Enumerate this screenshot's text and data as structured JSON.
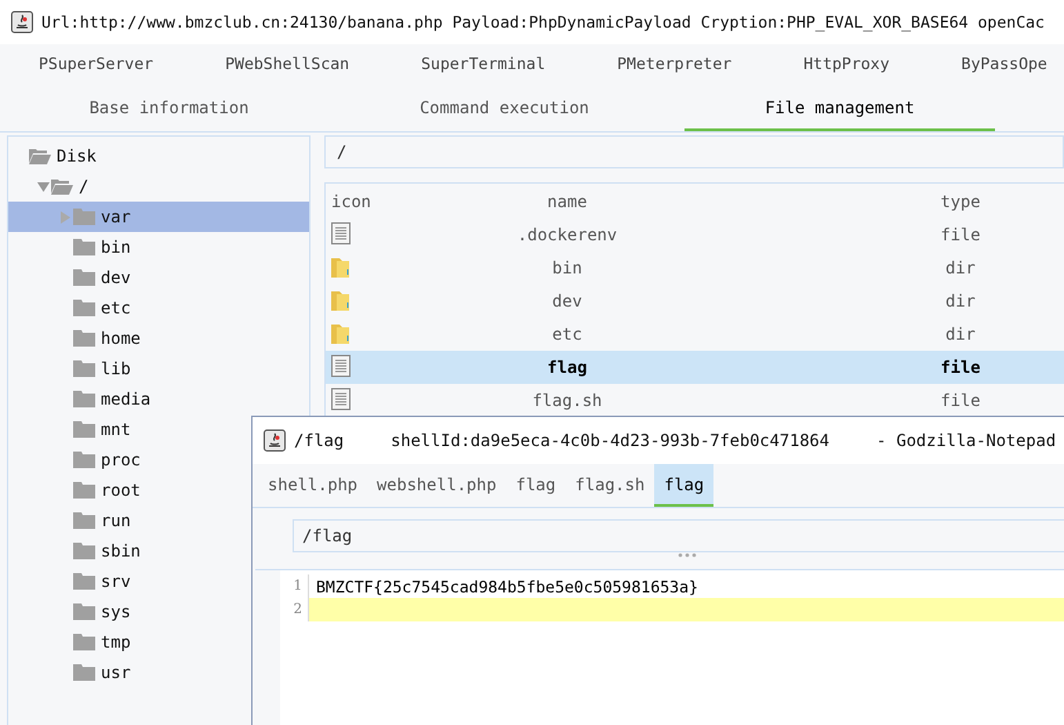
{
  "window": {
    "title": "Url:http://www.bmzclub.cn:24130/banana.php Payload:PhpDynamicPayload Cryption:PHP_EVAL_XOR_BASE64 openCac"
  },
  "plugin_tabs": [
    {
      "label": "PSuperServer",
      "selected": false
    },
    {
      "label": "PWebShellScan",
      "selected": false
    },
    {
      "label": "SuperTerminal",
      "selected": false
    },
    {
      "label": "PMeterpreter",
      "selected": false
    },
    {
      "label": "HttpProxy",
      "selected": false
    },
    {
      "label": "ByPassOpe",
      "selected": false
    }
  ],
  "tabs": [
    {
      "label": "Base information",
      "selected": false
    },
    {
      "label": "Command execution",
      "selected": false
    },
    {
      "label": "File management",
      "selected": true
    }
  ],
  "tree": {
    "items": [
      {
        "label": "Disk",
        "expandable": false,
        "expanded": true,
        "selected": false,
        "children": [
          {
            "label": "/",
            "expandable": true,
            "expanded": true,
            "selected": false,
            "children": [
              {
                "label": "var",
                "expandable": true,
                "expanded": false,
                "selected": true
              },
              {
                "label": "bin",
                "expandable": false,
                "expanded": false,
                "selected": false
              },
              {
                "label": "dev",
                "expandable": false,
                "expanded": false,
                "selected": false
              },
              {
                "label": "etc",
                "expandable": false,
                "expanded": false,
                "selected": false
              },
              {
                "label": "home",
                "expandable": false,
                "expanded": false,
                "selected": false
              },
              {
                "label": "lib",
                "expandable": false,
                "expanded": false,
                "selected": false
              },
              {
                "label": "media",
                "expandable": false,
                "expanded": false,
                "selected": false
              },
              {
                "label": "mnt",
                "expandable": false,
                "expanded": false,
                "selected": false
              },
              {
                "label": "proc",
                "expandable": false,
                "expanded": false,
                "selected": false
              },
              {
                "label": "root",
                "expandable": false,
                "expanded": false,
                "selected": false
              },
              {
                "label": "run",
                "expandable": false,
                "expanded": false,
                "selected": false
              },
              {
                "label": "sbin",
                "expandable": false,
                "expanded": false,
                "selected": false
              },
              {
                "label": "srv",
                "expandable": false,
                "expanded": false,
                "selected": false
              },
              {
                "label": "sys",
                "expandable": false,
                "expanded": false,
                "selected": false
              },
              {
                "label": "tmp",
                "expandable": false,
                "expanded": false,
                "selected": false
              },
              {
                "label": "usr",
                "expandable": false,
                "expanded": false,
                "selected": false
              }
            ]
          }
        ]
      }
    ]
  },
  "file_panel": {
    "path": "/",
    "table": {
      "columns": [
        "icon",
        "name",
        "type"
      ],
      "rows": [
        {
          "kind": "file",
          "name": ".dockerenv",
          "type": "file",
          "selected": false
        },
        {
          "kind": "dir",
          "name": "bin",
          "type": "dir",
          "selected": false
        },
        {
          "kind": "dir",
          "name": "dev",
          "type": "dir",
          "selected": false
        },
        {
          "kind": "dir",
          "name": "etc",
          "type": "dir",
          "selected": false
        },
        {
          "kind": "file",
          "name": "flag",
          "type": "file",
          "selected": true
        },
        {
          "kind": "file",
          "name": "flag.sh",
          "type": "file",
          "selected": false
        }
      ]
    }
  },
  "notepad": {
    "title": "/flag",
    "shell_id": "shellId:da9e5eca-4c0b-4d23-993b-7feb0c471864",
    "app_name": "- Godzilla-Notepad",
    "tabs": [
      {
        "label": "shell.php",
        "selected": false
      },
      {
        "label": "webshell.php",
        "selected": false
      },
      {
        "label": "flag",
        "selected": false
      },
      {
        "label": "flag.sh",
        "selected": false
      },
      {
        "label": "flag",
        "selected": true
      }
    ],
    "path": "/flag",
    "lines": [
      {
        "number": "1",
        "text": "BMZCTF{25c7545cad984b5fbe5e0c505981653a}",
        "current": false
      },
      {
        "number": "2",
        "current": true
      }
    ]
  }
}
